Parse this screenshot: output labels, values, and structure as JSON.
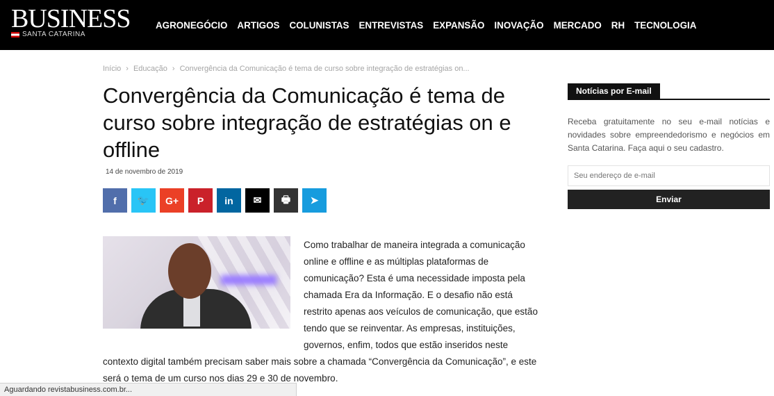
{
  "logo": {
    "main": "BUSINESS",
    "sub": "SANTA CATARINA"
  },
  "nav": [
    "AGRONEGÓCIO",
    "ARTIGOS",
    "COLUNISTAS",
    "ENTREVISTAS",
    "EXPANSÃO",
    "INOVAÇÃO",
    "MERCADO",
    "RH",
    "TECNOLOGIA"
  ],
  "breadcrumb": {
    "home": "Início",
    "sep1": "›",
    "section": "Educação",
    "sep2": "›",
    "current": "Convergência da Comunicação é tema de curso sobre integração de estratégias on..."
  },
  "article": {
    "title": "Convergência da Comunicação é tema de curso sobre integração de estratégias on e offline",
    "date": "14 de novembro de 2019",
    "body": "Como trabalhar de maneira integrada a comunicação online e offline e as múltiplas plataformas de comunicação? Esta é uma necessidade imposta pela chamada Era da Informação. E o desafio não está restrito apenas aos veículos de comunicação, que estão tendo que se reinventar. As empresas, instituições, governos, enfim, todos que estão inseridos neste contexto digital também precisam saber mais sobre a chamada “Convergência da Comunicação”, e este será o tema de um curso nos dias 29 e 30 de novembro."
  },
  "share": [
    {
      "icon": "facebook-icon",
      "glyph": "f",
      "color": "#516eab"
    },
    {
      "icon": "twitter-icon",
      "glyph": "🐦",
      "color": "#29c5f6"
    },
    {
      "icon": "google-plus-icon",
      "glyph": "G+",
      "color": "#eb4026"
    },
    {
      "icon": "pinterest-icon",
      "glyph": "P",
      "color": "#ca212a"
    },
    {
      "icon": "linkedin-icon",
      "glyph": "in",
      "color": "#0266a0"
    },
    {
      "icon": "email-icon",
      "glyph": "✉",
      "color": "#000000"
    },
    {
      "icon": "print-icon",
      "glyph": "🖶",
      "color": "#333333"
    },
    {
      "icon": "telegram-icon",
      "glyph": "➤",
      "color": "#179cde"
    }
  ],
  "sidebar": {
    "title": "Notícias por E-mail",
    "text": "Receba gratuitamente no seu e-mail notícias e novidades sobre empreendedorismo e negócios em Santa Catarina. Faça aqui o seu cadastro.",
    "email_placeholder": "Seu endereço de e-mail",
    "send_label": "Enviar"
  },
  "status_bar": "Aguardando revistabusiness.com.br..."
}
